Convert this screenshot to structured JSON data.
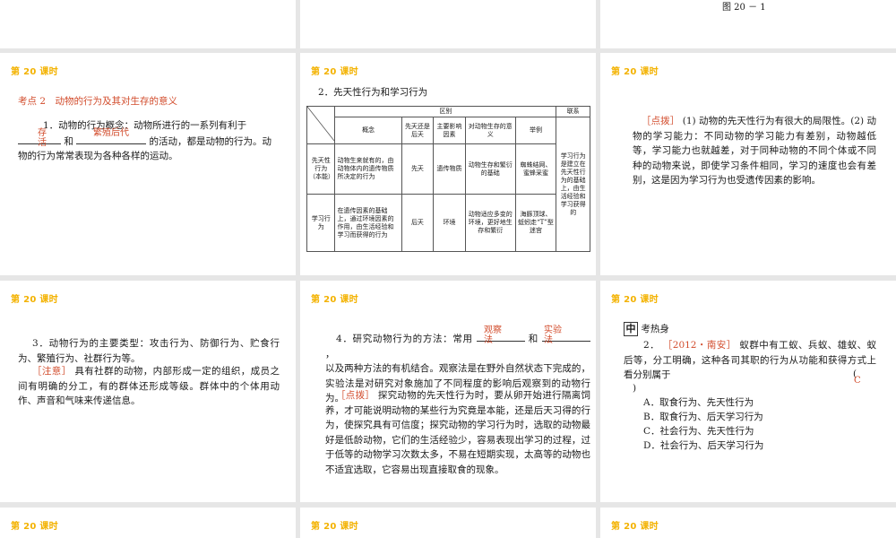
{
  "slide_title": "第 20 课时",
  "fig_caption": "图 20 － 1",
  "s4": {
    "kaodian": "考点 2　动物的行为及其对生存的意义",
    "line1_a": "1．动物的行为概念：动物所进行的一系列有利于",
    "ans1": "存活",
    "ans2": "繁殖后代",
    "line2_b": "和",
    "line2_c": "的活动，都是动物的行为。动",
    "line3": "物的行为常常表现为各种各样的运动。"
  },
  "s5": {
    "heading": "2．先天性行为和学习行为",
    "table": {
      "h_qubie": "区别",
      "h_lianxi": "联系",
      "cols": [
        "概念",
        "先天还是后天",
        "主要影响因素",
        "对动物生存的意义",
        "举例"
      ],
      "row1_head": "先天性行为（本能）",
      "row1": [
        "动物生来就有的，由动物体内的遗传物质所决定的行为",
        "先天",
        "遗传物质",
        "动物生存和繁衍的基础",
        "蜘蛛结网、蜜蜂采蜜"
      ],
      "row2_head": "学习行为",
      "row2": [
        "在遗传因素的基础上，通过环境因素的作用，由生活经验和学习而获得的行为",
        "后天",
        "环境",
        "动物适应多变的环境，更好地生存和繁衍",
        "海豚顶球、蚯蚓走“T”型迷宫"
      ],
      "lianxi": "学习行为是建立在先天性行为的基础上，由生活经验和学习获得的"
    }
  },
  "s6": {
    "dianbo": "［点拨］",
    "text": "(1) 动物的先天性行为有很大的局限性。(2) 动物的学习能力：不同动物的学习能力有差别，动物越低等，学习能力也就越差，对于同种动物的不同个体或不同种的动物来说，即使学习条件相同，学习的速度也会有差别，这是因为学习行为也受遗传因素的影响。"
  },
  "s7": {
    "p1": "3．动物行为的主要类型：攻击行为、防御行为、贮食行为、繁殖行为、社群行为等。",
    "zhuyi": "［注意］",
    "p2": "具有社群的动物，内部形成一定的组织，成员之间有明确的分工，有的群体还形成等级。群体中的个体用动作、声音和气味来传递信息。"
  },
  "s8": {
    "p1a": "4．研究动物行为的方法：常用",
    "ans1": "观察法",
    "p1b": "和",
    "ans2": "实验法",
    "p1c": "，",
    "p2": "以及两种方法的有机结合。观察法是在野外自然状态下完成的，实验法是对研究对象施加了不同程度的影响后观察到的动物行为。",
    "dianbo": "［点拨］",
    "p3": "探究动物的先天性行为时，要从卵开始进行隔离饲养，才可能说明动物的某些行为究竟是本能，还是后天习得的行为，使探究具有可信度；探究动物的学习行为时，选取的动物最好是低龄动物，它们的生活经验少，容易表现出学习的过程，过于低等的动物学习次数太多，不易在短期实现，太高等的动物也不适宜选取，它容易出现直接取食的现象。"
  },
  "s9": {
    "zhong": "中",
    "kaoreshen": "考热身",
    "q_num": "2．",
    "q_src": "［2012・南安］",
    "q_text": "蚁群中有工蚁、兵蚁、雄蚁、蚁后等，分工明确，这种各司其职的行为从功能和获得方式上看分别属于",
    "paren_open": "(",
    "answer": "C",
    "paren_close": ")",
    "options": [
      "A．取食行为、先天性行为",
      "B．取食行为、后天学习行为",
      "C．社会行为、先天性行为",
      "D．社会行为、后天学习行为"
    ]
  }
}
